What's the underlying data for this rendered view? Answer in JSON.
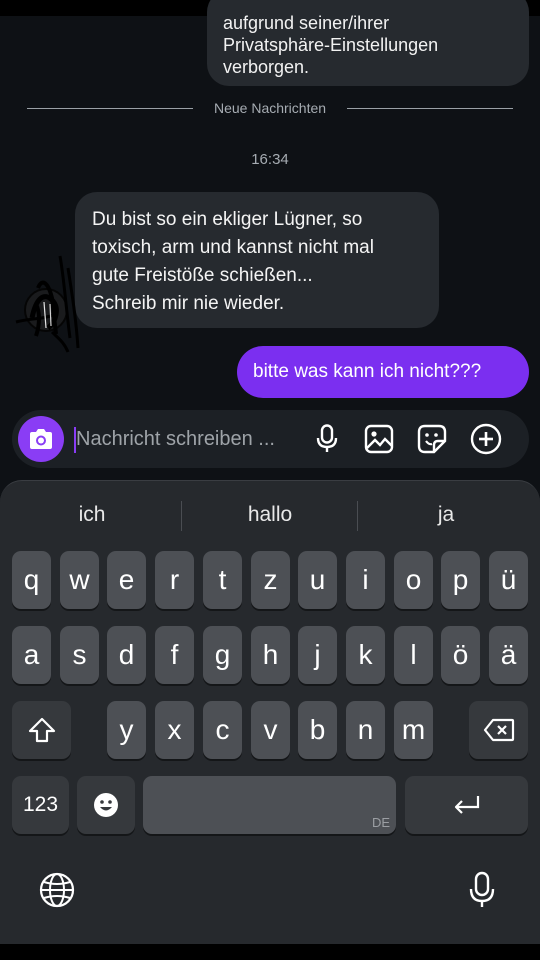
{
  "chat": {
    "top_bubble_lines": [
      "aufgrund seiner/ihrer",
      "Privatsphäre-Einstellungen",
      "verborgen."
    ],
    "divider_label": "Neue Nachrichten",
    "timestamp": "16:34",
    "incoming_lines": [
      "Du bist so ein ekliger Lügner, so",
      "toxisch, arm und kannst nicht mal",
      "gute Freistöße schießen...",
      "Schreib mir nie wieder."
    ],
    "outgoing_message": "bitte was kann ich nicht???"
  },
  "composer": {
    "placeholder": "Nachricht schreiben ...",
    "icons": [
      "camera-icon",
      "microphone-icon",
      "gallery-icon",
      "sticker-icon",
      "add-icon"
    ],
    "accent": "#8a3df5"
  },
  "keyboard": {
    "suggestions": [
      "ich",
      "hallo",
      "ja"
    ],
    "row1": [
      "q",
      "w",
      "e",
      "r",
      "t",
      "z",
      "u",
      "i",
      "o",
      "p",
      "ü"
    ],
    "row2": [
      "a",
      "s",
      "d",
      "f",
      "g",
      "h",
      "j",
      "k",
      "l",
      "ö",
      "ä"
    ],
    "row3": [
      "y",
      "x",
      "c",
      "v",
      "b",
      "n",
      "m"
    ],
    "numbers_label": "123",
    "space_lang": "DE",
    "icons": [
      "shift-icon",
      "backspace-icon",
      "emoji-icon",
      "return-icon",
      "globe-icon",
      "dictation-icon"
    ]
  },
  "colors": {
    "background": "#0e1115",
    "incoming_bubble": "#262a2f",
    "outgoing_bubble": "#7b2ff0",
    "key": "#4d5055",
    "keyboard": "#26292d"
  }
}
